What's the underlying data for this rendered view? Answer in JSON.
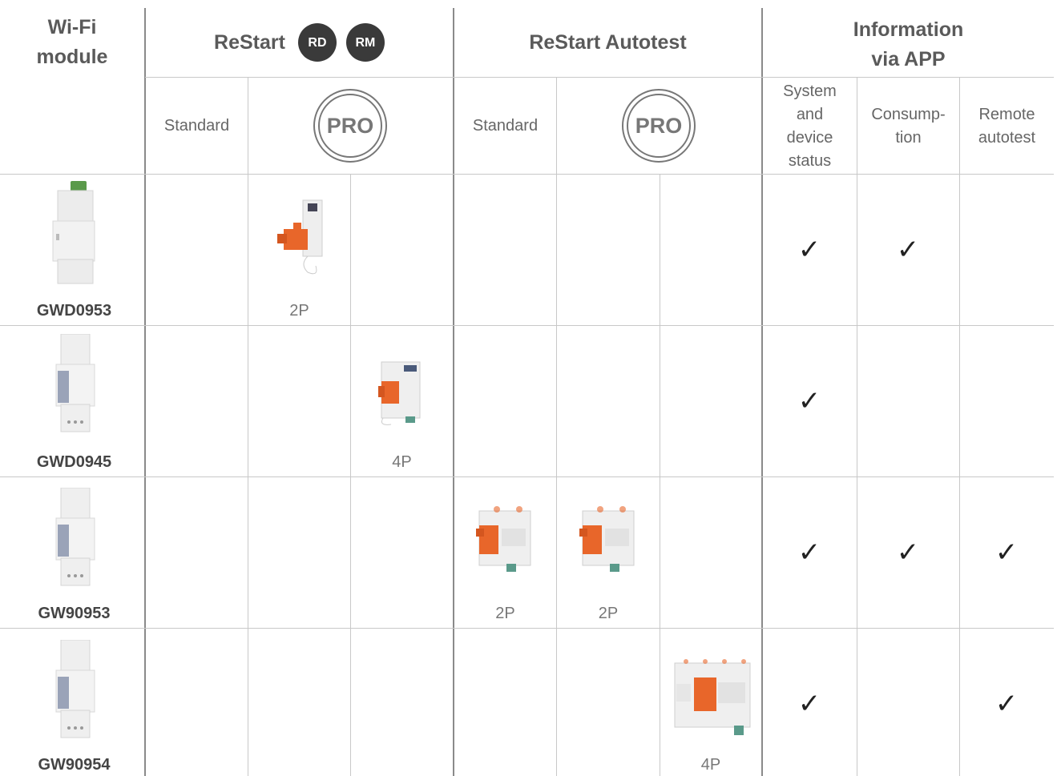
{
  "header": {
    "wifi_module": "Wi-Fi\nmodule",
    "restart": "ReStart",
    "badge_rd": "RD",
    "badge_rm": "RM",
    "restart_autotest": "ReStart Autotest",
    "information": "Information\nvia APP"
  },
  "subheader": {
    "standard_1": "Standard",
    "pro_1": "PRO",
    "standard_2": "Standard",
    "pro_2": "PRO",
    "system_status": "System\nand\ndevice\nstatus",
    "consumption": "Consump-\ntion",
    "remote_autotest": "Remote\nautotest"
  },
  "check_symbol": "✓",
  "rows": [
    {
      "code": "GWD0953",
      "pole_restart_pro_a": "2P",
      "pole_restart_pro_b": "",
      "pole_autotest_std": "",
      "pole_autotest_pro_a": "",
      "pole_autotest_pro_b": "",
      "system_status": true,
      "consumption": true,
      "remote_autotest": false
    },
    {
      "code": "GWD0945",
      "pole_restart_pro_a": "",
      "pole_restart_pro_b": "4P",
      "pole_autotest_std": "",
      "pole_autotest_pro_a": "",
      "pole_autotest_pro_b": "",
      "system_status": true,
      "consumption": false,
      "remote_autotest": false
    },
    {
      "code": "GW90953",
      "pole_restart_pro_a": "",
      "pole_restart_pro_b": "",
      "pole_autotest_std": "2P",
      "pole_autotest_pro_a": "2P",
      "pole_autotest_pro_b": "",
      "system_status": true,
      "consumption": true,
      "remote_autotest": true
    },
    {
      "code": "GW90954",
      "pole_restart_pro_a": "",
      "pole_restart_pro_b": "",
      "pole_autotest_std": "",
      "pole_autotest_pro_a": "",
      "pole_autotest_pro_b": "4P",
      "system_status": true,
      "consumption": false,
      "remote_autotest": true
    }
  ],
  "colors": {
    "accent_orange": "#e8662a",
    "badge_dark": "#3a3a3a",
    "grid_line": "#c8c8c8"
  }
}
